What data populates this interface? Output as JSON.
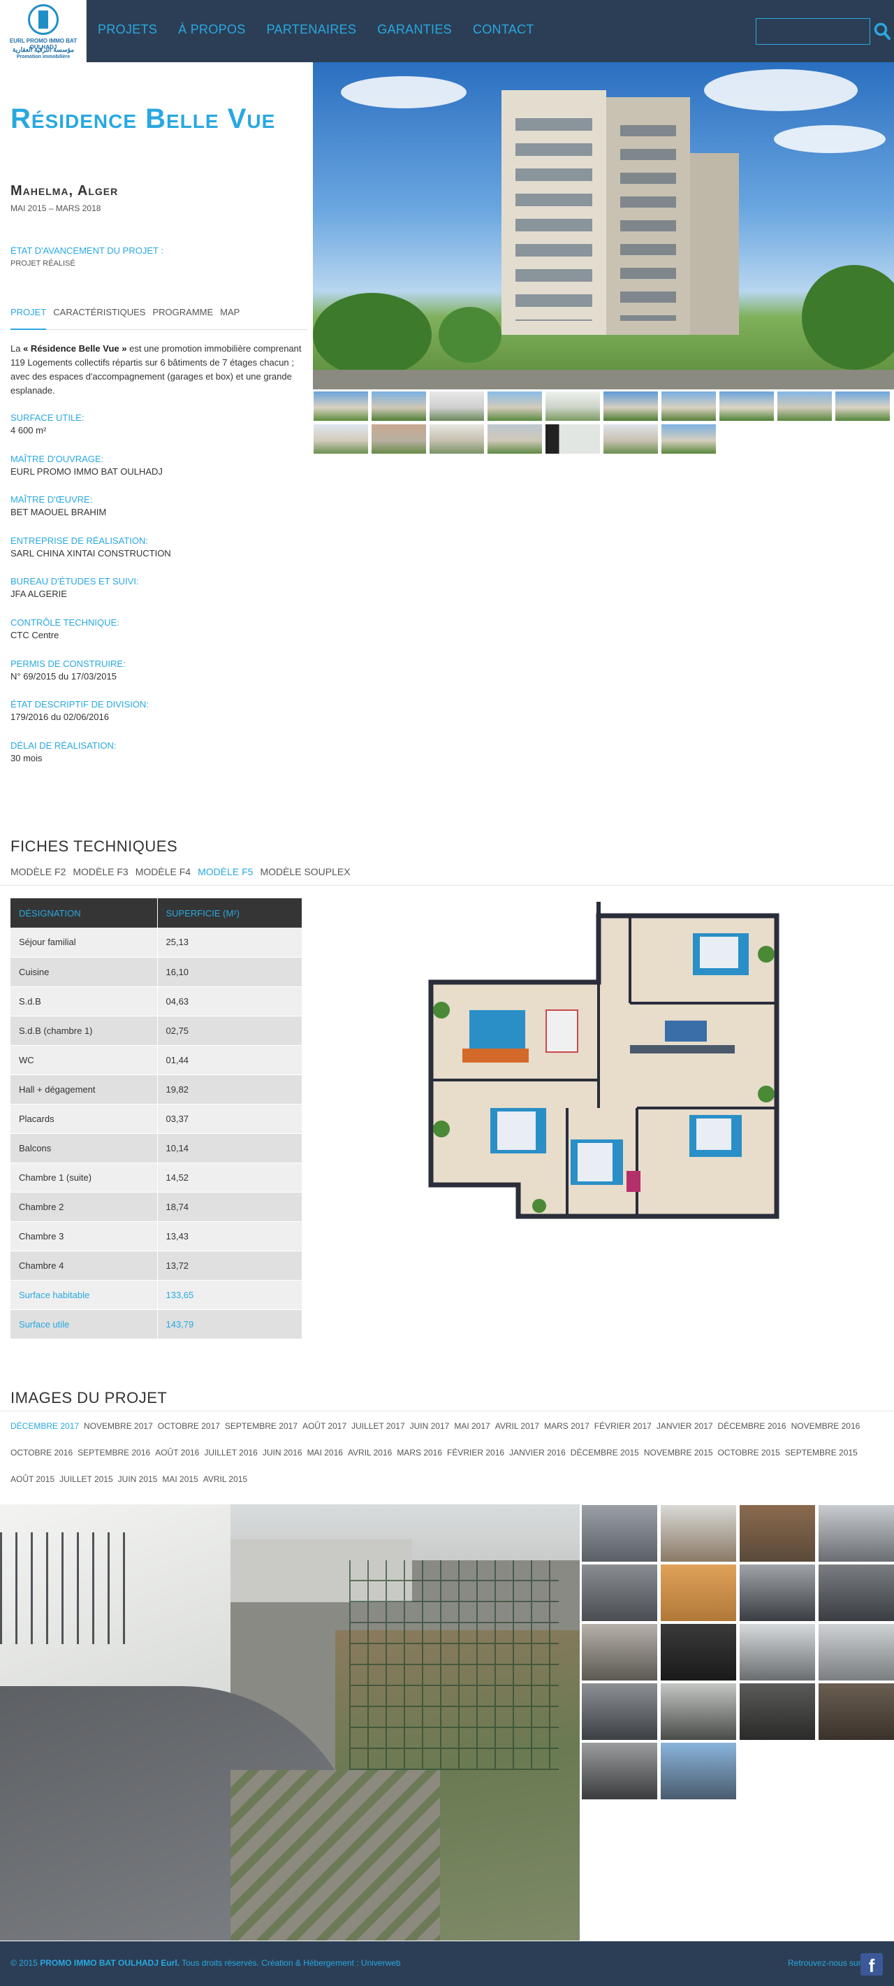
{
  "header": {
    "logo": {
      "text_latin": "EURL PROMO IMMO BAT OULHADJ",
      "text_arabic": "مؤسسة الترقية العقارية",
      "tagline": "Promotion immobilière"
    },
    "nav": [
      "Projets",
      "À propos",
      "Partenaires",
      "Garanties",
      "Contact"
    ],
    "search": {
      "value": "",
      "placeholder": ""
    },
    "search_icon": "search-icon"
  },
  "project": {
    "title": "Résidence Belle Vue",
    "location": "Mahelma, Alger",
    "date_start": "Mai 2015",
    "date_sep": "–",
    "date_end": "Mars 2018",
    "state_label": "État d'avancement du projet :",
    "state_value": "Projet réalisé",
    "tabs": [
      "Projet",
      "Caractéristiques",
      "Programme",
      "Map"
    ],
    "active_tab": "Projet",
    "intro_prefix": "La",
    "intro_name": "« Résidence Belle Vue »",
    "intro_rest": "est une promotion immobilière comprenant 119 Logements collectifs répartis sur 6 bâtiments de 7 étages chacun ; avec des espaces d'accompagnement (garages et box) et une grande esplanade.",
    "facts": [
      {
        "label": "Surface utile:",
        "value": "4 600 m²"
      },
      {
        "label": "Maître d'ouvrage:",
        "value": "EURL PROMO IMMO BAT OULHADJ"
      },
      {
        "label": "Maître d'œuvre:",
        "value": "BET MAOUEL BRAHIM"
      },
      {
        "label": "Entreprise de réalisation:",
        "value": "SARL CHINA XINTAI CONSTRUCTION"
      },
      {
        "label": "Bureau d'études et suivi:",
        "value": "JFA ALGERIE"
      },
      {
        "label": "Contrôle technique:",
        "value": "CTC Centre"
      },
      {
        "label": "Permis de construire:",
        "value": "N° 69/2015 du 17/03/2015"
      },
      {
        "label": "État descriptif de division:",
        "value": "179/2016 du 02/06/2016"
      },
      {
        "label": "Délai de réalisation:",
        "value": "30 mois"
      }
    ]
  },
  "fiches": {
    "title": "Fiches techniques",
    "models": [
      "Modèle F2",
      "Modèle F3",
      "Modèle F4",
      "Modèle F5",
      "Modèle Souplex"
    ],
    "active_model": "Modèle F5",
    "columns": [
      "Désignation",
      "Superficie (M²)"
    ],
    "rows": [
      [
        "Séjour familial",
        "25,13"
      ],
      [
        "Cuisine",
        "16,10"
      ],
      [
        "S.d.B",
        "04,63"
      ],
      [
        "S.d.B (chambre 1)",
        "02,75"
      ],
      [
        "WC",
        "01,44"
      ],
      [
        "Hall + dégagement",
        "19,82"
      ],
      [
        "Placards",
        "03,37"
      ],
      [
        "Balcons",
        "10,14"
      ],
      [
        "Chambre 1 (suite)",
        "14,52"
      ],
      [
        "Chambre 2",
        "18,74"
      ],
      [
        "Chambre 3",
        "13,43"
      ],
      [
        "Chambre 4",
        "13,72"
      ],
      [
        "Surface habitable",
        "133,65"
      ],
      [
        "Surface utile",
        "143,79"
      ]
    ]
  },
  "images": {
    "title": "Images du projet",
    "months": [
      "Décembre 2017",
      "Novembre 2017",
      "Octobre 2017",
      "Septembre 2017",
      "Août 2017",
      "Juillet 2017",
      "Juin 2017",
      "Mai 2017",
      "Avril 2017",
      "Mars 2017",
      "Février 2017",
      "Janvier 2017",
      "Décembre 2016",
      "Novembre 2016",
      "Octobre 2016",
      "Septembre 2016",
      "Août 2016",
      "Juillet 2016",
      "Juin 2016",
      "Mai 2016",
      "Avril 2016",
      "Mars 2016",
      "Février 2016",
      "Janvier 2016",
      "Décembre 2015",
      "Novembre 2015",
      "Octobre 2015",
      "Septembre 2015",
      "Août 2015",
      "Juillet 2015",
      "Juin 2015",
      "Mai 2015",
      "Avril 2015"
    ],
    "active_month": "Décembre 2017"
  },
  "footer": {
    "copyright_prefix": "© 2015",
    "company": "PROMO IMMO BAT OULHADJ Eurl.",
    "copyright_rest": "Tous droits réservés. Création & Hébergement : Univerweb",
    "facebook_label": "Retrouvez-nous sur",
    "facebook_icon": "facebook-icon"
  },
  "colors": {
    "accent": "#29a8e0",
    "header_bg": "#2c3e55",
    "table_header_bg": "#353535"
  }
}
